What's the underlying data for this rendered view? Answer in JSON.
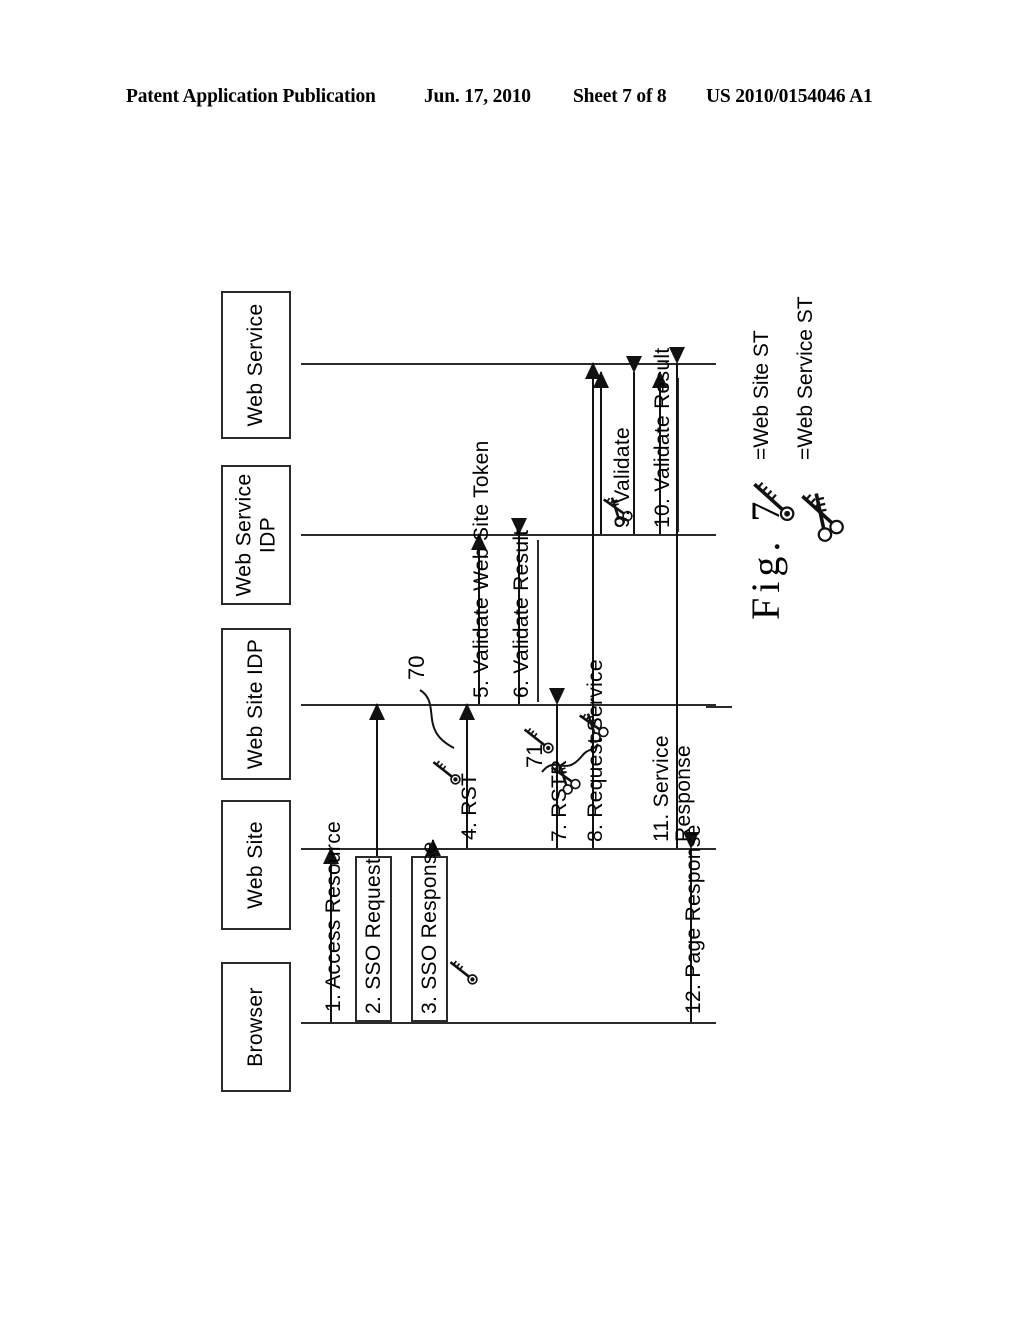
{
  "header": {
    "publication": "Patent Application Publication",
    "date": "Jun. 17, 2010",
    "sheet": "Sheet 7 of 8",
    "number": "US 2010/0154046 A1"
  },
  "figure": {
    "caption": "Fig. 7",
    "participants": [
      {
        "id": "web-service",
        "label": "Web Service"
      },
      {
        "id": "web-service-idp",
        "label": "Web Service\nIDP"
      },
      {
        "id": "web-site-idp",
        "label": "Web Site IDP"
      },
      {
        "id": "web-site",
        "label": "Web Site"
      },
      {
        "id": "browser",
        "label": "Browser"
      }
    ],
    "messages": [
      {
        "num": "1.",
        "label": "1. Access Resource",
        "from": "browser",
        "to": "web-site",
        "icon": "none",
        "boxed": false
      },
      {
        "num": "2.",
        "label": "2. SSO Request",
        "from": "browser",
        "to": "web-site-idp",
        "icon": "none",
        "boxed": true
      },
      {
        "num": "3.",
        "label": "3. SSO Response",
        "from": "web-site-idp",
        "to": "browser",
        "icon": "key",
        "boxed": true
      },
      {
        "num": "4.",
        "label": "4. RST",
        "from": "web-site",
        "to": "web-site-idp",
        "icon": "key",
        "boxed": false
      },
      {
        "num": "5.",
        "label": "5. Validate Web Site Token",
        "from": "web-site-idp",
        "to": "web-service-idp",
        "icon": "none",
        "boxed": false
      },
      {
        "num": "6.",
        "label": "6. Validate Result",
        "from": "web-service-idp",
        "to": "web-site-idp",
        "icon": "none",
        "boxed": false
      },
      {
        "num": "7.",
        "label": "7. RSTR",
        "from": "web-site-idp",
        "to": "web-site",
        "icon": "keys",
        "boxed": false
      },
      {
        "num": "8.",
        "label": "8. Request Service",
        "from": "web-site",
        "to": "web-service",
        "icon": "keys",
        "boxed": false
      },
      {
        "num": "9.",
        "label": "9. Validate",
        "from": "web-service",
        "to": "web-service-idp",
        "icon": "keys",
        "boxed": false
      },
      {
        "num": "10.",
        "label": "10. Validate Result",
        "from": "web-service-idp",
        "to": "web-service",
        "icon": "none",
        "boxed": false
      },
      {
        "num": "11.",
        "label": "11. Service\nResponse",
        "from": "web-service",
        "to": "web-site",
        "icon": "none",
        "boxed": false
      },
      {
        "num": "12.",
        "label": "12. Page Response",
        "from": "web-site",
        "to": "browser",
        "icon": "none",
        "boxed": false
      }
    ],
    "reference_numerals": [
      {
        "id": "70",
        "value": "70"
      },
      {
        "id": "71",
        "value": "71"
      }
    ],
    "legend": [
      {
        "icon": "key",
        "text": "=Web Site ST"
      },
      {
        "icon": "keys",
        "text": "=Web Service ST"
      }
    ]
  },
  "msg_labels": {
    "m1": "1. Access Resource",
    "m2": "2. SSO Request",
    "m3": "3. SSO Response",
    "m4": "4. RST",
    "m5": "5. Validate Web Site Token",
    "m6": "6. Validate Result",
    "m7": "7. RSTR",
    "m8": "8. Request Service",
    "m9": "9. Validate",
    "m10": "10. Validate Result",
    "m11a": "11. Service",
    "m11b": "Response",
    "m12": "12. Page Response"
  },
  "participant_labels": {
    "p1": "Web Service",
    "p2a": "Web Service",
    "p2b": "IDP",
    "p3": "Web Site IDP",
    "p4": "Web Site",
    "p5": "Browser"
  },
  "legend_labels": {
    "l1": "=Web Site ST",
    "l2": "=Web Service ST"
  },
  "refs": {
    "r70": "70",
    "r71": "71"
  },
  "colors": {
    "ink": "#111111",
    "line": "#2b2b2b",
    "paper": "#ffffff"
  }
}
